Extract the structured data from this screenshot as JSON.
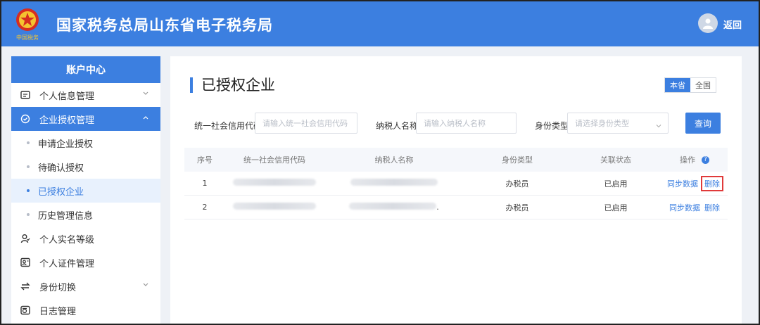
{
  "header": {
    "site_title": "国家税务总局山东省电子税务局",
    "emblem_text": "中国税务",
    "back_label": "返回"
  },
  "sidebar": {
    "heading": "账户中心",
    "items": [
      {
        "label": "个人信息管理",
        "icon": "id-card-icon"
      },
      {
        "label": "企业授权管理",
        "icon": "shield-check-icon"
      },
      {
        "label": "个人实名等级",
        "icon": "user-level-icon"
      },
      {
        "label": "个人证件管理",
        "icon": "certificate-icon"
      },
      {
        "label": "身份切换",
        "icon": "switch-icon"
      },
      {
        "label": "日志管理",
        "icon": "log-icon"
      }
    ],
    "sub_items": [
      {
        "label": "申请企业授权"
      },
      {
        "label": "待确认授权"
      },
      {
        "label": "已授权企业"
      },
      {
        "label": "历史管理信息"
      }
    ]
  },
  "main": {
    "title": "已授权企业",
    "scope": {
      "local": "本省",
      "national": "全国"
    },
    "filters": {
      "credit_code_label": "统一社会信用代码",
      "credit_code_placeholder": "请输入统一社会信用代码",
      "taxpayer_label": "纳税人名称",
      "taxpayer_placeholder": "请输入纳税人名称",
      "identity_label": "身份类型",
      "identity_placeholder": "请选择身份类型",
      "query_label": "查询"
    },
    "table": {
      "headers": {
        "no": "序号",
        "code": "统一社会信用代码",
        "name": "纳税人名称",
        "type": "身份类型",
        "status": "关联状态",
        "op": "操作"
      },
      "rows": [
        {
          "no": "1",
          "type": "办税员",
          "status": "已启用",
          "sync": "同步数据",
          "delete": "删除"
        },
        {
          "no": "2",
          "name_suffix": ".",
          "type": "办税员",
          "status": "已启用",
          "sync": "同步数据",
          "delete": "删除"
        }
      ]
    }
  },
  "colors": {
    "primary": "#3c7fe0",
    "highlight": "#e03a3a"
  }
}
